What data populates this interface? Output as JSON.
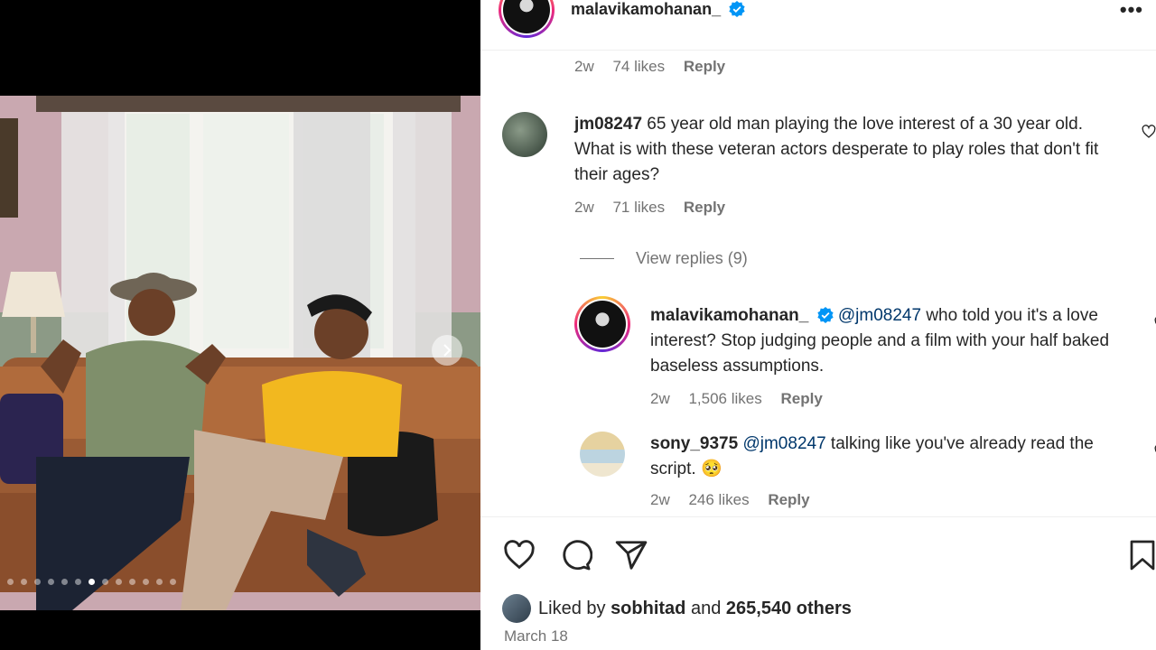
{
  "post": {
    "author": "malavikamohanan_",
    "more_icon": "more-icon",
    "carousel": {
      "total": 13,
      "active_index": 6
    }
  },
  "first_comment_meta": {
    "time": "2w",
    "likes": "74 likes",
    "reply": "Reply"
  },
  "comments": [
    {
      "user": "jm08247",
      "text": " 65 year old man playing the love interest of a 30 year old. What is with these veteran actors desperate to play roles that don't fit their ages?",
      "time": "2w",
      "likes": "71 likes",
      "reply": "Reply"
    }
  ],
  "view_replies": "View replies (9)",
  "replies": [
    {
      "user": "malavikamohanan_",
      "mention": "@jm08247",
      "text": " who told you it's a love interest? Stop judging people and a film with your half baked baseless assumptions.",
      "time": "2w",
      "likes": "1,506 likes",
      "reply": "Reply"
    },
    {
      "user": "sony_9375",
      "mention": "@jm08247",
      "text": " talking like you've already read the script. 🥺",
      "time": "2w",
      "likes": "246 likes",
      "reply": "Reply"
    }
  ],
  "likes": {
    "prefix": "Liked by ",
    "user": "sobhitad",
    "middle": " and ",
    "others": "265,540 others"
  },
  "date": "March 18",
  "colors": {
    "link": "#00376b",
    "meta": "#737373",
    "verified": "#0095f6"
  }
}
